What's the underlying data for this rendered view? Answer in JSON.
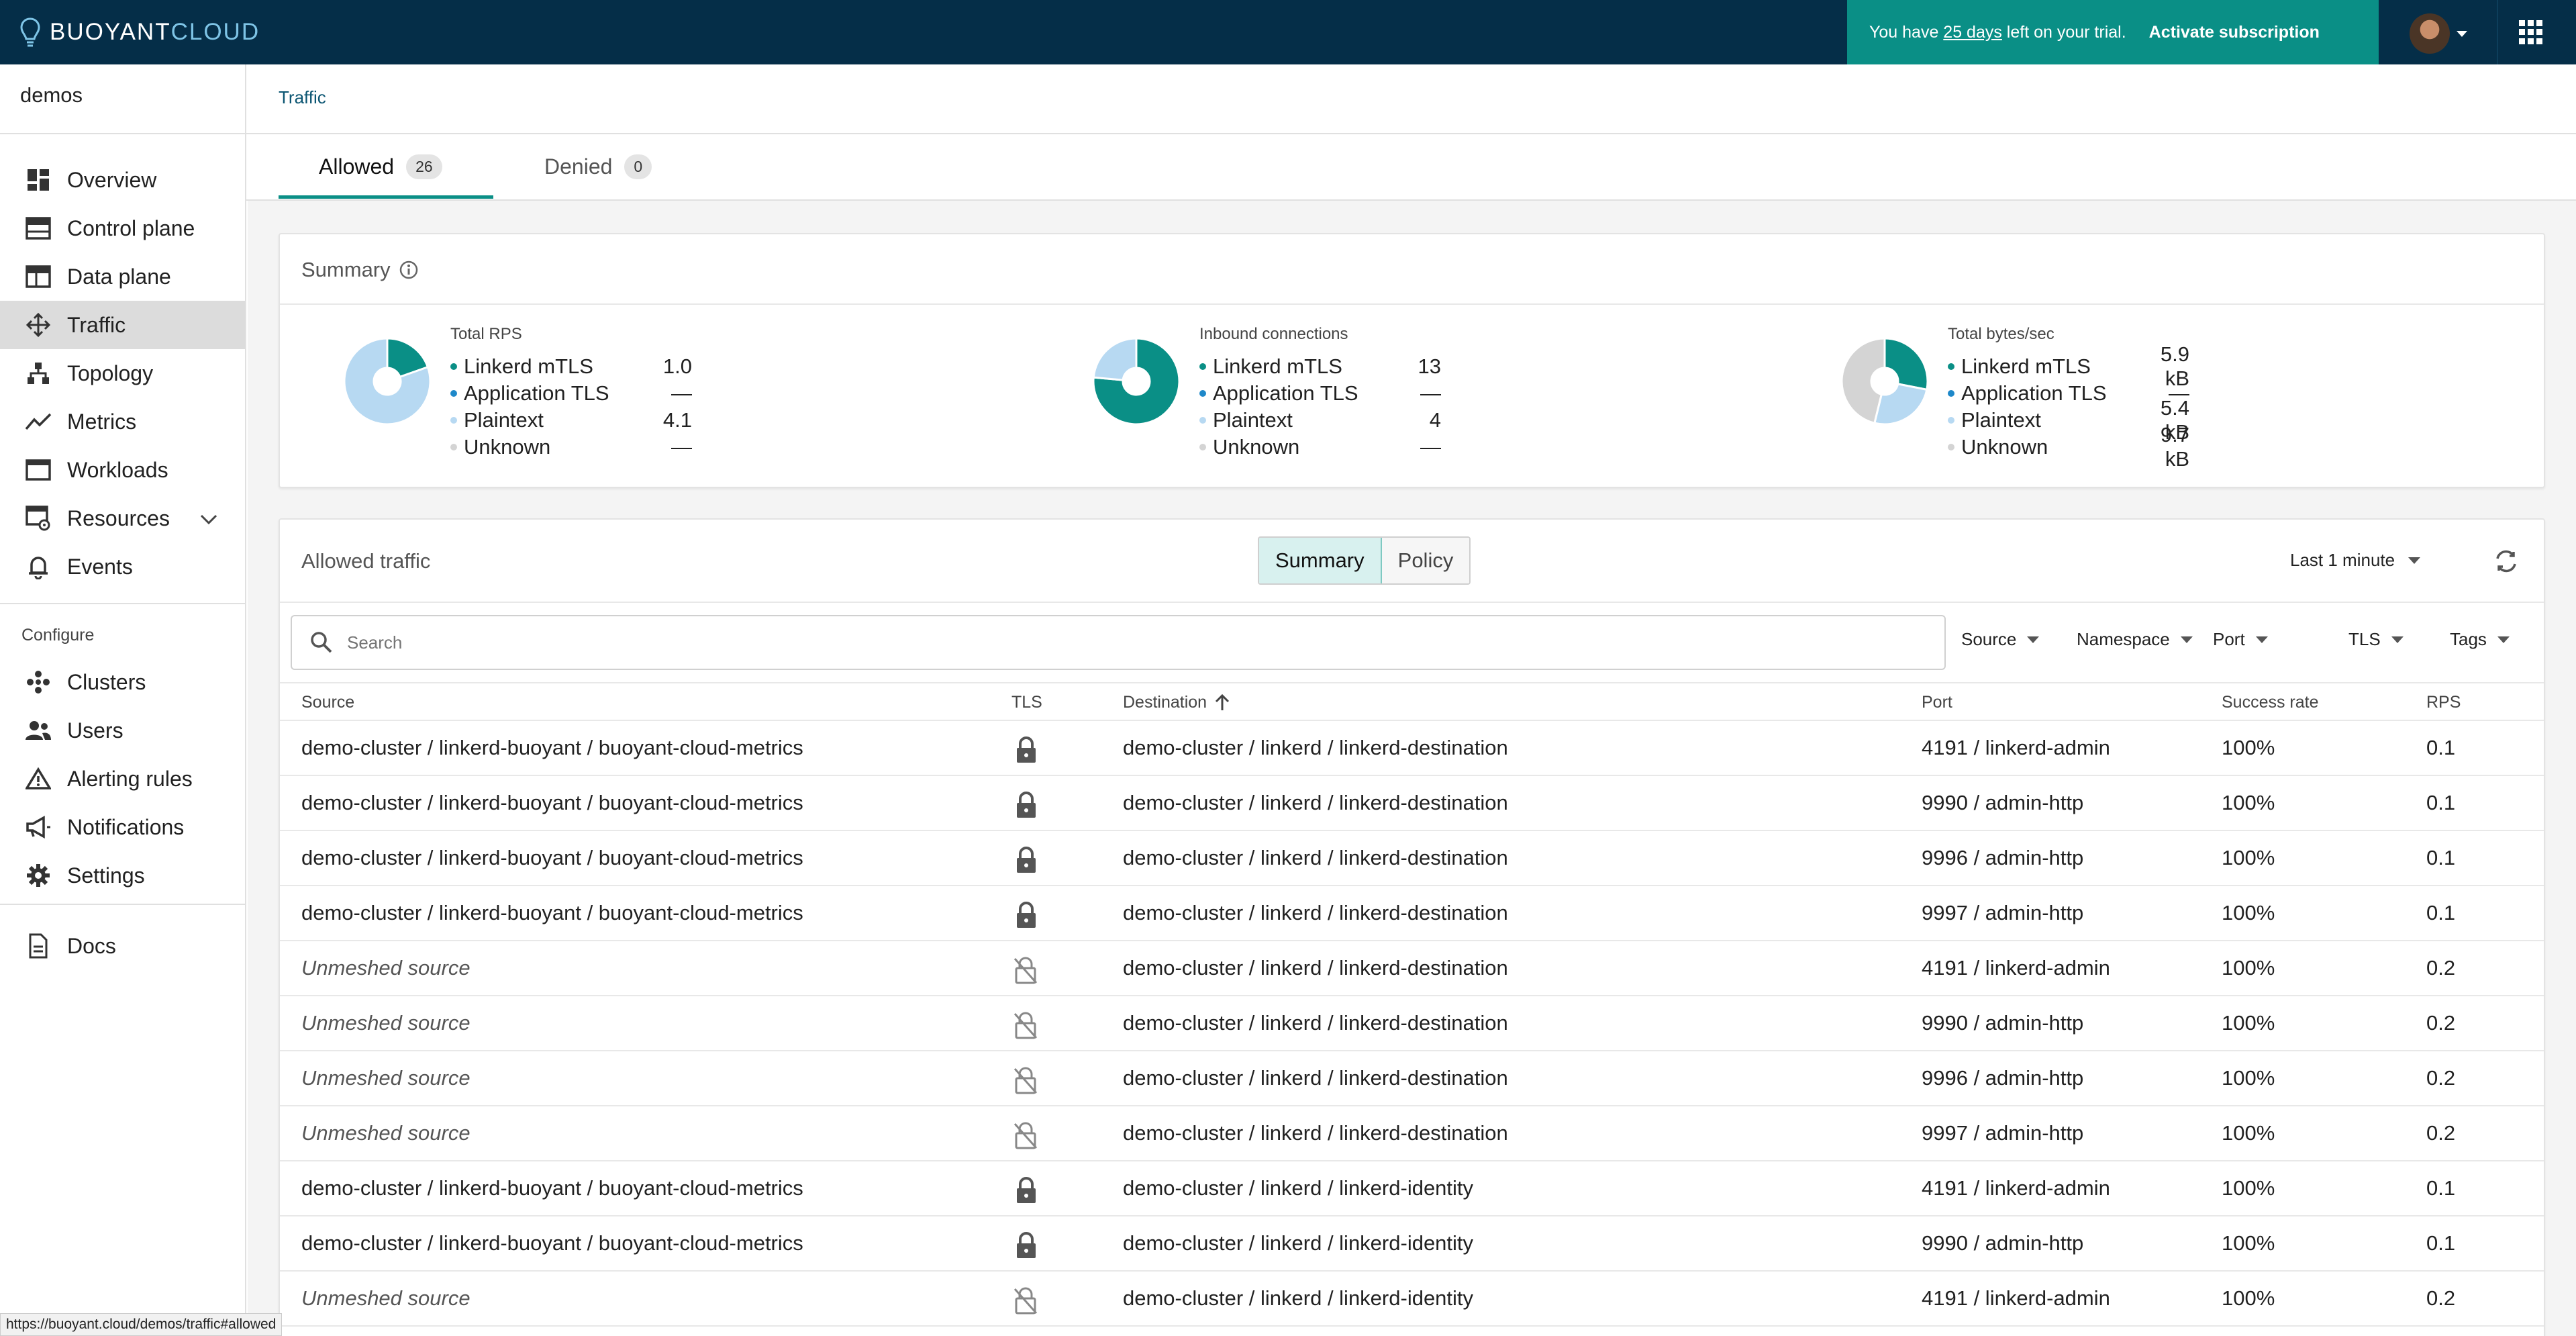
{
  "brand": {
    "part1": "BUOYANT",
    "part2": "CLOUD"
  },
  "trial": {
    "prefix": "You have ",
    "days": "25 days",
    "suffix": " left on your trial.",
    "action": "Activate subscription"
  },
  "status_url": "https://buoyant.cloud/demos/traffic#allowed",
  "sidebar": {
    "org": "demos",
    "nav": [
      {
        "label": "Overview",
        "icon": "dashboard-icon"
      },
      {
        "label": "Control plane",
        "icon": "control-plane-icon"
      },
      {
        "label": "Data plane",
        "icon": "data-plane-icon"
      },
      {
        "label": "Traffic",
        "icon": "traffic-icon",
        "active": true
      },
      {
        "label": "Topology",
        "icon": "topology-icon"
      },
      {
        "label": "Metrics",
        "icon": "metrics-icon"
      },
      {
        "label": "Workloads",
        "icon": "workloads-icon"
      },
      {
        "label": "Resources",
        "icon": "resources-icon"
      },
      {
        "label": "Events",
        "icon": "bell-icon"
      }
    ],
    "configure_label": "Configure",
    "configure": [
      {
        "label": "Clusters",
        "icon": "clusters-icon"
      },
      {
        "label": "Users",
        "icon": "users-icon"
      },
      {
        "label": "Alerting rules",
        "icon": "warning-icon"
      },
      {
        "label": "Notifications",
        "icon": "megaphone-icon"
      },
      {
        "label": "Settings",
        "icon": "gear-icon"
      }
    ],
    "docs": "Docs"
  },
  "breadcrumb": "Traffic",
  "tabs": [
    {
      "label": "Allowed",
      "count": "26"
    },
    {
      "label": "Denied",
      "count": "0"
    }
  ],
  "summary": {
    "title": "Summary",
    "colors": {
      "mtls": "#0a8f86",
      "apptls": "#1e88c9",
      "plaintext": "#b7d9f2",
      "unknown": "#d4d4d4"
    },
    "metrics": [
      {
        "title": "Total RPS",
        "rows": [
          {
            "name": "Linkerd mTLS",
            "value": "1.0"
          },
          {
            "name": "Application TLS",
            "value": "—"
          },
          {
            "name": "Plaintext",
            "value": "4.1"
          },
          {
            "name": "Unknown",
            "value": "—"
          }
        ]
      },
      {
        "title": "Inbound connections",
        "rows": [
          {
            "name": "Linkerd mTLS",
            "value": "13"
          },
          {
            "name": "Application TLS",
            "value": "—"
          },
          {
            "name": "Plaintext",
            "value": "4"
          },
          {
            "name": "Unknown",
            "value": "—"
          }
        ]
      },
      {
        "title": "Total bytes/sec",
        "rows": [
          {
            "name": "Linkerd mTLS",
            "value": "5.9 kB"
          },
          {
            "name": "Application TLS",
            "value": "—"
          },
          {
            "name": "Plaintext",
            "value": "5.4 kB"
          },
          {
            "name": "Unknown",
            "value": "9.7 kB"
          }
        ]
      }
    ],
    "slices": [
      [
        1.0,
        0,
        4.1,
        0
      ],
      [
        13,
        0,
        4,
        0
      ],
      [
        5.9,
        0,
        5.4,
        9.7
      ]
    ]
  },
  "table": {
    "title": "Allowed traffic",
    "view_toggle": [
      "Summary",
      "Policy"
    ],
    "time_range": "Last 1 minute",
    "search_placeholder": "Search",
    "filters": [
      "Source",
      "Namespace",
      "Port",
      "TLS",
      "Tags"
    ],
    "columns": [
      "Source",
      "TLS",
      "Destination",
      "Port",
      "Success rate",
      "RPS"
    ],
    "rows": [
      {
        "source": "demo-cluster / linkerd-buoyant / buoyant-cloud-metrics",
        "tls": "locked",
        "destination": "demo-cluster / linkerd / linkerd-destination",
        "port": "4191 / linkerd-admin",
        "success": "100%",
        "rps": "0.1"
      },
      {
        "source": "demo-cluster / linkerd-buoyant / buoyant-cloud-metrics",
        "tls": "locked",
        "destination": "demo-cluster / linkerd / linkerd-destination",
        "port": "9990 / admin-http",
        "success": "100%",
        "rps": "0.1"
      },
      {
        "source": "demo-cluster / linkerd-buoyant / buoyant-cloud-metrics",
        "tls": "locked",
        "destination": "demo-cluster / linkerd / linkerd-destination",
        "port": "9996 / admin-http",
        "success": "100%",
        "rps": "0.1"
      },
      {
        "source": "demo-cluster / linkerd-buoyant / buoyant-cloud-metrics",
        "tls": "locked",
        "destination": "demo-cluster / linkerd / linkerd-destination",
        "port": "9997 / admin-http",
        "success": "100%",
        "rps": "0.1"
      },
      {
        "source": "Unmeshed source",
        "tls": "unlocked",
        "destination": "demo-cluster / linkerd / linkerd-destination",
        "port": "4191 / linkerd-admin",
        "success": "100%",
        "rps": "0.2"
      },
      {
        "source": "Unmeshed source",
        "tls": "unlocked",
        "destination": "demo-cluster / linkerd / linkerd-destination",
        "port": "9990 / admin-http",
        "success": "100%",
        "rps": "0.2"
      },
      {
        "source": "Unmeshed source",
        "tls": "unlocked",
        "destination": "demo-cluster / linkerd / linkerd-destination",
        "port": "9996 / admin-http",
        "success": "100%",
        "rps": "0.2"
      },
      {
        "source": "Unmeshed source",
        "tls": "unlocked",
        "destination": "demo-cluster / linkerd / linkerd-destination",
        "port": "9997 / admin-http",
        "success": "100%",
        "rps": "0.2"
      },
      {
        "source": "demo-cluster / linkerd-buoyant / buoyant-cloud-metrics",
        "tls": "locked",
        "destination": "demo-cluster / linkerd / linkerd-identity",
        "port": "4191 / linkerd-admin",
        "success": "100%",
        "rps": "0.1"
      },
      {
        "source": "demo-cluster / linkerd-buoyant / buoyant-cloud-metrics",
        "tls": "locked",
        "destination": "demo-cluster / linkerd / linkerd-identity",
        "port": "9990 / admin-http",
        "success": "100%",
        "rps": "0.1"
      },
      {
        "source": "Unmeshed source",
        "tls": "unlocked",
        "destination": "demo-cluster / linkerd / linkerd-identity",
        "port": "4191 / linkerd-admin",
        "success": "100%",
        "rps": "0.2"
      }
    ]
  }
}
